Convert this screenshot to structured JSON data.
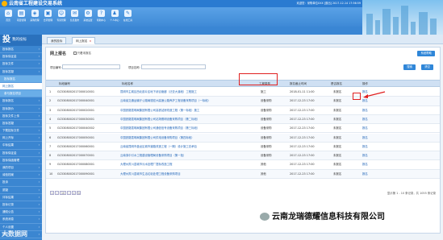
{
  "header": {
    "title": "云南省工程建设交易系统",
    "user_info": "欢迎您：采购单位XXX   [退出]   2017-12-14 17:56:59"
  },
  "toolbar": {
    "items": [
      {
        "label": "首页",
        "icon": "home-icon",
        "glyph": "⌂"
      },
      {
        "label": "项目管理",
        "icon": "folder-icon",
        "glyph": "▤"
      },
      {
        "label": "采购管理",
        "icon": "cart-icon",
        "glyph": "◈"
      },
      {
        "label": "合同管理",
        "icon": "document-icon",
        "glyph": "▣"
      },
      {
        "label": "专家管理",
        "icon": "user-icon",
        "glyph": "☺"
      },
      {
        "label": "信息发布",
        "icon": "notice-icon",
        "glyph": "✉"
      },
      {
        "label": "系统设置",
        "icon": "gear-icon",
        "glyph": "⚙"
      },
      {
        "label": "帮助中心",
        "icon": "help-icon",
        "glyph": "?"
      },
      {
        "label": "个人中心",
        "icon": "person-icon",
        "glyph": "♟"
      },
      {
        "label": "在线工具",
        "icon": "tool-icon",
        "glyph": "✎"
      }
    ]
  },
  "nav": {
    "big": "投",
    "heading": "我的投标",
    "items": [
      {
        "label": "投标报名",
        "state": ""
      },
      {
        "label": "投标保证金",
        "state": ""
      },
      {
        "label": "投标文件",
        "state": ""
      },
      {
        "label": "投标答疑",
        "state": ""
      },
      {
        "label": "投标报名",
        "state": "sub"
      },
      {
        "label": "网上报名",
        "state": "active"
      },
      {
        "label": "参与报名项目",
        "state": "sub"
      },
      {
        "label": "投标报名",
        "state": ""
      },
      {
        "label": "投标报价",
        "state": ""
      },
      {
        "label": "投标文件上传",
        "state": ""
      },
      {
        "label": "投标答疑",
        "state": ""
      },
      {
        "label": "下载招标文件",
        "state": ""
      },
      {
        "label": "网上开标",
        "state": ""
      },
      {
        "label": "中标结果",
        "state": ""
      },
      {
        "label": "投标保证金",
        "state": ""
      },
      {
        "label": "投标保函管理",
        "state": ""
      },
      {
        "label": "我的项目",
        "state": ""
      },
      {
        "label": "诚信档案",
        "state": ""
      },
      {
        "label": "投诉",
        "state": ""
      },
      {
        "label": "质疑",
        "state": ""
      },
      {
        "label": "评标结果",
        "state": ""
      },
      {
        "label": "投标记录",
        "state": ""
      },
      {
        "label": "通知公告",
        "state": ""
      },
      {
        "label": "系统消息",
        "state": ""
      },
      {
        "label": "个人设置",
        "state": ""
      },
      {
        "label": "退出",
        "state": ""
      }
    ]
  },
  "tabs": [
    {
      "label": "我的投标",
      "active": false
    },
    {
      "label": "网上报名",
      "active": true
    }
  ],
  "panel": {
    "title": "网上报名",
    "checkbox_label": "只看未报名",
    "top_button": "系统帮助",
    "filter": {
      "code_label": "项目编号:",
      "name_label": "项目名称:",
      "search_button": "搜索",
      "reset_button": "清空"
    }
  },
  "table": {
    "headers": {
      "code": "标段编号",
      "name": "标段名称",
      "type": "工程类型",
      "deadline": "报名截止时间",
      "status": "是否报名",
      "op": "操作"
    },
    "rows": [
      {
        "idx": "1",
        "code": "GC5308002017000010001",
        "name": "昆明市主城区西北部片区地下综合管廊（泛亚大道段）工程施工",
        "type": "施工",
        "deadline": "2018-01-11 11:00",
        "status": "未报名",
        "op": "报名"
      },
      {
        "idx": "2",
        "code": "GC5308002017000040001",
        "name": "云南省交通运输厅公路局德宏州高速公路养护工程设备采购项目（一标段）",
        "type": "设备采购",
        "deadline": "2017-12-23 17:00",
        "status": "未报名",
        "op": "报名"
      },
      {
        "idx": "3",
        "code": "GC5308002017000020001",
        "name": "中国铁路昆明局集团有限公司高铁站房改造工程（第一标段）施工",
        "type": "设备采购",
        "deadline": "2017-12-23 17:00",
        "status": "未报名",
        "op": "报名"
      },
      {
        "idx": "4",
        "code": "GC5308002017000030001",
        "name": "中国铁路昆明局集团有限公司站场照明设备采购项目（第二标段）",
        "type": "设备采购",
        "deadline": "2017-12-23 17:00",
        "status": "未报名",
        "op": "报名"
      },
      {
        "idx": "5",
        "code": "GC5308002017000040002",
        "name": "中国铁路昆明局集团有限公司通信信号设备采购项目（第三标段）",
        "type": "设备采购",
        "deadline": "2017-12-23 17:00",
        "status": "未报名",
        "op": "报名"
      },
      {
        "idx": "6",
        "code": "GC5308002017000050001",
        "name": "中国铁路昆明局集团有限公司供电设备采购项目（第四标段）",
        "type": "设备采购",
        "deadline": "2017-12-23 17:00",
        "status": "未报名",
        "op": "报名"
      },
      {
        "idx": "7",
        "code": "GC5308002017000060001",
        "name": "云南省昆明市盘龙区城市道路改造工程（一期）设计施工总承包",
        "type": "设备采购",
        "deadline": "2017-12-23 17:00",
        "status": "未报名",
        "op": "报名"
      },
      {
        "idx": "8",
        "code": "GC5308002017000070001",
        "name": "云南滇中引水工程建设管理局设备采购项目（第一批）",
        "type": "设备采购",
        "deadline": "2017-12-23 17:00",
        "status": "未报名",
        "op": "报名"
      },
      {
        "idx": "9",
        "code": "GC5308002017000080001",
        "name": "大理州宾川县城市污水处理厂提标改造工程",
        "type": "其他",
        "deadline": "2017-12-23 17:00",
        "status": "未报名",
        "op": "报名"
      },
      {
        "idx": "10",
        "code": "GC5308002017000090001",
        "name": "大理州宾川县城市生活垃圾处理工程设备采购项目",
        "type": "其他",
        "deadline": "2017-12-23 17:00",
        "status": "未报名",
        "op": "报名"
      }
    ]
  },
  "footer": {
    "page_size": "10",
    "page_info": "显示第 1 - 10 条记录，共 1055 条记录"
  },
  "watermarks": {
    "left": "大数据网",
    "right": "云南龙瑞德耀信息科技有限公司"
  },
  "colors": {
    "header_blue": "#2a7bd1",
    "highlight_red": "#e02020"
  }
}
